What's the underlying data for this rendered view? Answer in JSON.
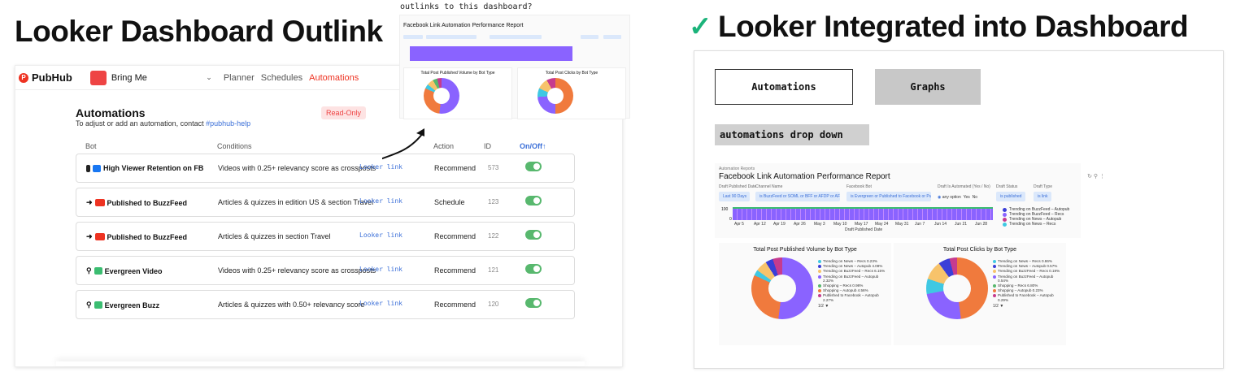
{
  "titles": {
    "left": "Looker Dashboard Outlink",
    "right": "Looker Integrated into Dashboard",
    "question": "outlinks to this dashboard?"
  },
  "pubhub": {
    "logo": "PubHub",
    "brand": "Bring Me",
    "nav": [
      "Planner",
      "Schedules",
      "Automations"
    ],
    "heading": "Automations",
    "subtitle_prefix": "To adjust or add an automation, contact ",
    "subtitle_link": "#pubhub-help",
    "readonly": "Read-Only",
    "columns": {
      "bot": "Bot",
      "conditions": "Conditions",
      "action": "Action",
      "id": "ID",
      "onoff": "On/Off↑"
    },
    "rows": [
      {
        "bot": "High Viewer Retention on FB",
        "conditions": "Videos with 0.25+ relevancy score as crossposts",
        "link": "Looker link",
        "action": "Recommend",
        "id": "573",
        "on": true
      },
      {
        "bot": "Published to BuzzFeed",
        "conditions": "Articles & quizzes in edition US & section Travel",
        "link": "Looker link",
        "action": "Schedule",
        "id": "123",
        "on": true
      },
      {
        "bot": "Published to BuzzFeed",
        "conditions": "Articles & quizzes in section Travel",
        "link": "Looker link",
        "action": "Recommend",
        "id": "122",
        "on": true
      },
      {
        "bot": "Evergreen Video",
        "conditions": "Videos with 0.25+ relevancy score as crossposts",
        "link": "Looker link",
        "action": "Recommend",
        "id": "121",
        "on": true
      },
      {
        "bot": "Evergreen Buzz",
        "conditions": "Articles & quizzes with 0.50+ relevancy score",
        "link": "Looker link",
        "action": "Recommend",
        "id": "120",
        "on": true
      }
    ]
  },
  "thumb": {
    "title": "Facebook Link Automation Performance Report",
    "card1": "Total Post Published Volume by Bot Type",
    "card2": "Total Post Clicks by Bot Type"
  },
  "integrated": {
    "tab_automations": "Automations",
    "tab_graphs": "Graphs",
    "dropdown": "automations drop down",
    "report": {
      "small": "Automation Reports",
      "title": "Facebook Link Automation Performance Report",
      "filters": [
        {
          "label": "Draft Published Date",
          "value": "Last 90 Days"
        },
        {
          "label": "Channel Name",
          "value": "is BuzzFeed or SOML or BFF or AFDP or AFF..."
        },
        {
          "label": "Facebook Bot",
          "value": "is Evergreen or Published to Facebook or Pu..."
        },
        {
          "label": "Draft Is Automated (Yes / No)",
          "value": "any option"
        },
        {
          "label": "Draft Status",
          "value": "is published"
        },
        {
          "label": "Draft Type",
          "value": "is link"
        }
      ],
      "yes": "Yes",
      "no": "No",
      "ymax": "100",
      "y0": "0",
      "xticks": [
        "Apr 5",
        "Apr 12",
        "Apr 19",
        "Apr 26",
        "May 3",
        "May 10",
        "May 17",
        "May 24",
        "May 31",
        "Jun 7",
        "Jun 14",
        "Jun 21",
        "Jun 28"
      ],
      "xlabel": "Draft Published Date",
      "legend": [
        "Trending on BuzzFeed – Autopub",
        "Trending on BuzzFeed – Recs",
        "Trending on News – Autopub",
        "Trending on News – Recs"
      ],
      "card1_title": "Total Post Published Volume by Bot Type",
      "card2_title": "Total Post Clicks by Bot Type",
      "card1_legend": [
        "Trending on News – Recs 0.23%",
        "Trending on News – Autopub 4.08%",
        "Trending on BuzzFeed – Recs 6.15%",
        "Trending on BuzzFeed – Autopub 2.32%",
        "Shopping – Recs 0.98%",
        "Shopping – Autopub 4.56%",
        "Published to Facebook – Autopub 2.27%"
      ],
      "card2_legend": [
        "Trending on News – Recs 0.86%",
        "Trending on News – Autopub 0.57%",
        "Trending on BuzzFeed – Recs 0.19%",
        "Trending on BuzzFeed – Autopub 0.54%",
        "Shopping – Recs 6.80%",
        "Shopping – Autopub 0.23%",
        "Published to Facebook – Autopub 0.29%"
      ],
      "pager": "1/2 ▼"
    }
  }
}
